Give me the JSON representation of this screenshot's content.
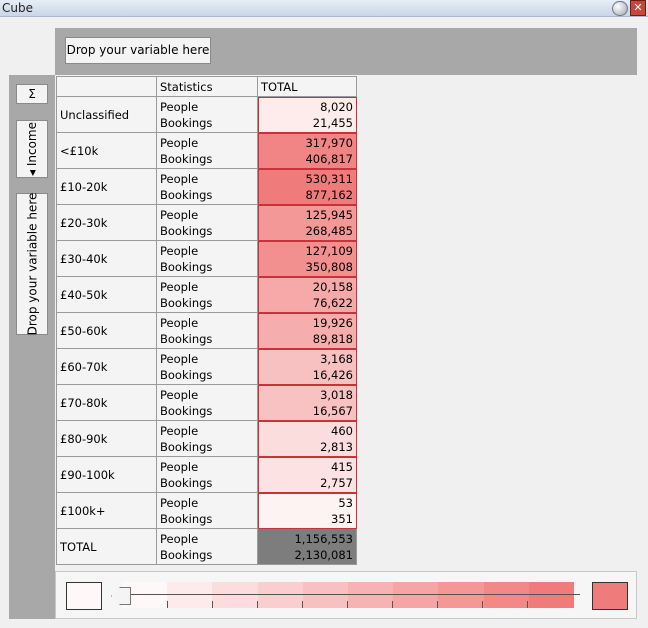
{
  "window": {
    "title": "Cube"
  },
  "columns_drop": {
    "label": "Drop your variable here"
  },
  "rows_panel": {
    "sigma": "Σ",
    "variable": "Income",
    "drop_label": "Drop your variable here"
  },
  "table": {
    "headers": {
      "label": "",
      "statistics": "Statistics",
      "total": "TOTAL"
    },
    "stat_names": [
      "People",
      "Bookings"
    ],
    "rows": [
      {
        "label": "Unclassified",
        "people": "8,020",
        "bookings": "21,455",
        "intensity": 0.1
      },
      {
        "label": "<£10k",
        "people": "317,970",
        "bookings": "406,817",
        "intensity": 0.93
      },
      {
        "label": "£10-20k",
        "people": "530,311",
        "bookings": "877,162",
        "intensity": 1.0
      },
      {
        "label": "£20-30k",
        "people": "125,945",
        "bookings": "268,485",
        "intensity": 0.78
      },
      {
        "label": "£30-40k",
        "people": "127,109",
        "bookings": "350,808",
        "intensity": 0.84
      },
      {
        "label": "£40-50k",
        "people": "20,158",
        "bookings": "76,622",
        "intensity": 0.63
      },
      {
        "label": "£50-60k",
        "people": "19,926",
        "bookings": "89,818",
        "intensity": 0.6
      },
      {
        "label": "£60-70k",
        "people": "3,168",
        "bookings": "16,426",
        "intensity": 0.44
      },
      {
        "label": "£70-80k",
        "people": "3,018",
        "bookings": "16,567",
        "intensity": 0.43
      },
      {
        "label": "£80-90k",
        "people": "460",
        "bookings": "2,813",
        "intensity": 0.22
      },
      {
        "label": "£90-100k",
        "people": "415",
        "bookings": "2,757",
        "intensity": 0.18
      },
      {
        "label": "£100k+",
        "people": "53",
        "bookings": "351",
        "intensity": 0.04
      }
    ],
    "total_row": {
      "label": "TOTAL",
      "people": "1,156,553",
      "bookings": "2,130,081"
    }
  },
  "colors": {
    "low": "#fff8f8",
    "high": "#f07b7b",
    "selected_border": "#c8323a",
    "total_bg": "#7d7d7d",
    "panel_gray": "#a8a8a8"
  },
  "legend": {
    "steps": 10
  }
}
